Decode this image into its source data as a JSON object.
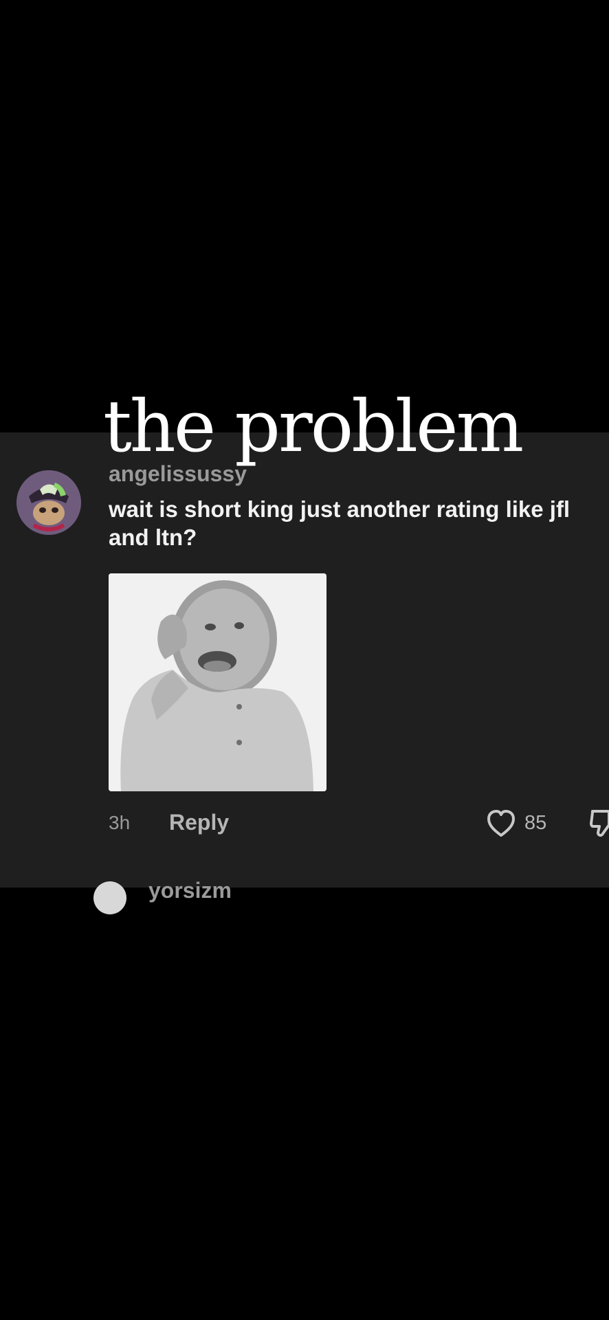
{
  "overlay": {
    "caption": "the problem"
  },
  "comment": {
    "username": "angelissussy",
    "text": "wait is short king just another rating like jfl and ltn?",
    "time": "3h",
    "reply_label": "Reply",
    "like_count": "85",
    "media_description": "black and white baby laughing meme image"
  },
  "next_comment": {
    "username": "yorsizm"
  },
  "icons": {
    "like": "heart-outline-icon",
    "dislike": "thumbs-down-icon"
  },
  "colors": {
    "panel_background": "#1f1f1f",
    "page_background": "#000000",
    "username_gray": "#9a9a9a",
    "comment_text": "#f2f2f2"
  }
}
